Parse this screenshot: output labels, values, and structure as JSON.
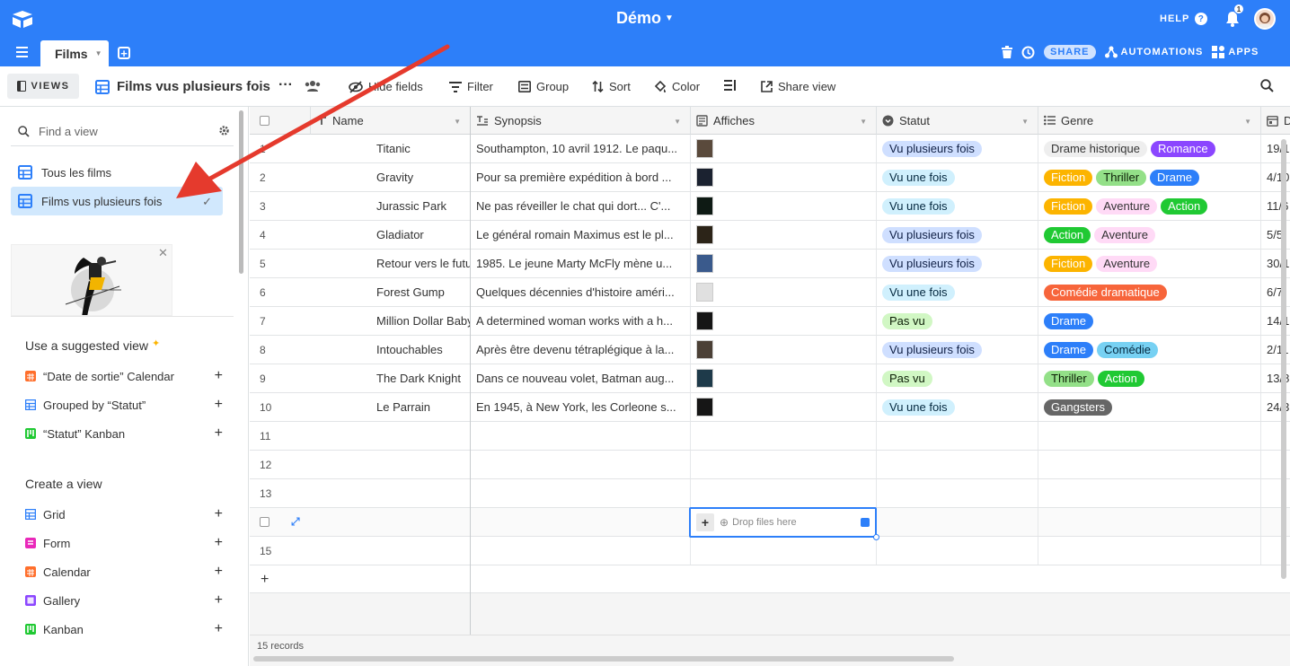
{
  "base": {
    "title": "Démo"
  },
  "header": {
    "help_label": "HELP",
    "notification_count": "1",
    "table_tab": "Films",
    "share_label": "SHARE",
    "automations_label": "AUTOMATIONS",
    "apps_label": "APPS"
  },
  "toolbar": {
    "views_label": "VIEWS",
    "view_title": "Films vus plusieurs fois",
    "hide_fields": "Hide fields",
    "filter": "Filter",
    "group": "Group",
    "sort": "Sort",
    "color": "Color",
    "share_view": "Share view"
  },
  "sidebar": {
    "find_placeholder": "Find a view",
    "views": [
      {
        "label": "Tous les films"
      },
      {
        "label": "Films vus plusieurs fois"
      }
    ],
    "suggested_heading": "Use a suggested view",
    "suggested": [
      {
        "label": "“Date de sortie” Calendar",
        "icon": "calendar-icon"
      },
      {
        "label": "Grouped by “Statut”",
        "icon": "grid-icon"
      },
      {
        "label": "“Statut” Kanban",
        "icon": "kanban-icon"
      }
    ],
    "create_heading": "Create a view",
    "create": [
      {
        "label": "Grid",
        "color": "#2d7ff9"
      },
      {
        "label": "Form",
        "color": "#e929ba"
      },
      {
        "label": "Calendar",
        "color": "#ff6f2c"
      },
      {
        "label": "Gallery",
        "color": "#8b46ff"
      },
      {
        "label": "Kanban",
        "color": "#20c933"
      }
    ]
  },
  "grid": {
    "columns": [
      {
        "label": "Name"
      },
      {
        "label": "Synopsis"
      },
      {
        "label": "Affiches"
      },
      {
        "label": "Statut"
      },
      {
        "label": "Genre"
      },
      {
        "label": "D"
      }
    ],
    "rows": [
      {
        "num": "1",
        "name": "Titanic",
        "synopsis": "Southampton, 10 avril 1912. Le paqu...",
        "statut": "Vu plusieurs fois",
        "genres": [
          "Drame historique",
          "Romance"
        ],
        "date": "19/1"
      },
      {
        "num": "2",
        "name": "Gravity",
        "synopsis": "Pour sa première expédition à bord ...",
        "statut": "Vu une fois",
        "genres": [
          "Fiction",
          "Thriller",
          "Drame"
        ],
        "date": "4/10"
      },
      {
        "num": "3",
        "name": "Jurassic Park",
        "synopsis": "Ne pas réveiller le chat qui dort... C'...",
        "statut": "Vu une fois",
        "genres": [
          "Fiction",
          "Aventure",
          "Action"
        ],
        "date": "11/6"
      },
      {
        "num": "4",
        "name": "Gladiator",
        "synopsis": "Le général romain Maximus est le pl...",
        "statut": "Vu plusieurs fois",
        "genres": [
          "Action",
          "Aventure"
        ],
        "date": "5/5/"
      },
      {
        "num": "5",
        "name": "Retour vers le futur",
        "synopsis": "1985. Le jeune Marty McFly mène u...",
        "statut": "Vu plusieurs fois",
        "genres": [
          "Fiction",
          "Aventure"
        ],
        "date": "30/1"
      },
      {
        "num": "6",
        "name": "Forest Gump",
        "synopsis": "Quelques décennies d'histoire améri...",
        "statut": "Vu une fois",
        "genres": [
          "Comédie dramatique"
        ],
        "date": "6/7/"
      },
      {
        "num": "7",
        "name": "Million Dollar Baby",
        "synopsis": "A determined woman works with a h...",
        "statut": "Pas vu",
        "genres": [
          "Drame"
        ],
        "date": "14/1"
      },
      {
        "num": "8",
        "name": "Intouchables",
        "synopsis": "Après être devenu tétraplégique à la...",
        "statut": "Vu plusieurs fois",
        "genres": [
          "Drame",
          "Comédie"
        ],
        "date": "2/11"
      },
      {
        "num": "9",
        "name": "The Dark Knight",
        "synopsis": "Dans ce nouveau volet, Batman aug...",
        "statut": "Pas vu",
        "genres": [
          "Thriller",
          "Action"
        ],
        "date": "13/8"
      },
      {
        "num": "10",
        "name": "Le Parrain",
        "synopsis": "En 1945, à New York, les Corleone s...",
        "statut": "Vu une fois",
        "genres": [
          "Gangsters"
        ],
        "date": "24/3"
      },
      {
        "num": "11"
      },
      {
        "num": "12"
      },
      {
        "num": "13"
      },
      {
        "num": ""
      },
      {
        "num": "15"
      }
    ],
    "drop_label": "Drop files here",
    "records_label": "15 records"
  },
  "colors": {
    "accent": "#2d7ff9",
    "statut": {
      "Vu plusieurs fois": [
        "#cfdfff",
        "#102046"
      ],
      "Vu une fois": [
        "#d0f0fd",
        "#04283f"
      ],
      "Pas vu": [
        "#d1f7c4",
        "#0b1d05"
      ]
    },
    "genre": {
      "Drame historique": [
        "#eeeeee",
        "#333333"
      ],
      "Romance": [
        "#8b46ff",
        "#ffffff"
      ],
      "Fiction": [
        "#fcb400",
        "#ffffff"
      ],
      "Thriller": [
        "#93e088",
        "#0b1d05"
      ],
      "Drame": [
        "#2d7ff9",
        "#ffffff"
      ],
      "Aventure": [
        "#ffdaf6",
        "#333333"
      ],
      "Action": [
        "#20c933",
        "#ffffff"
      ],
      "Comédie dramatique": [
        "#f7653b",
        "#ffffff"
      ],
      "Comédie": [
        "#77d1f3",
        "#04283f"
      ],
      "Gangsters": [
        "#666666",
        "#ffffff"
      ]
    }
  }
}
